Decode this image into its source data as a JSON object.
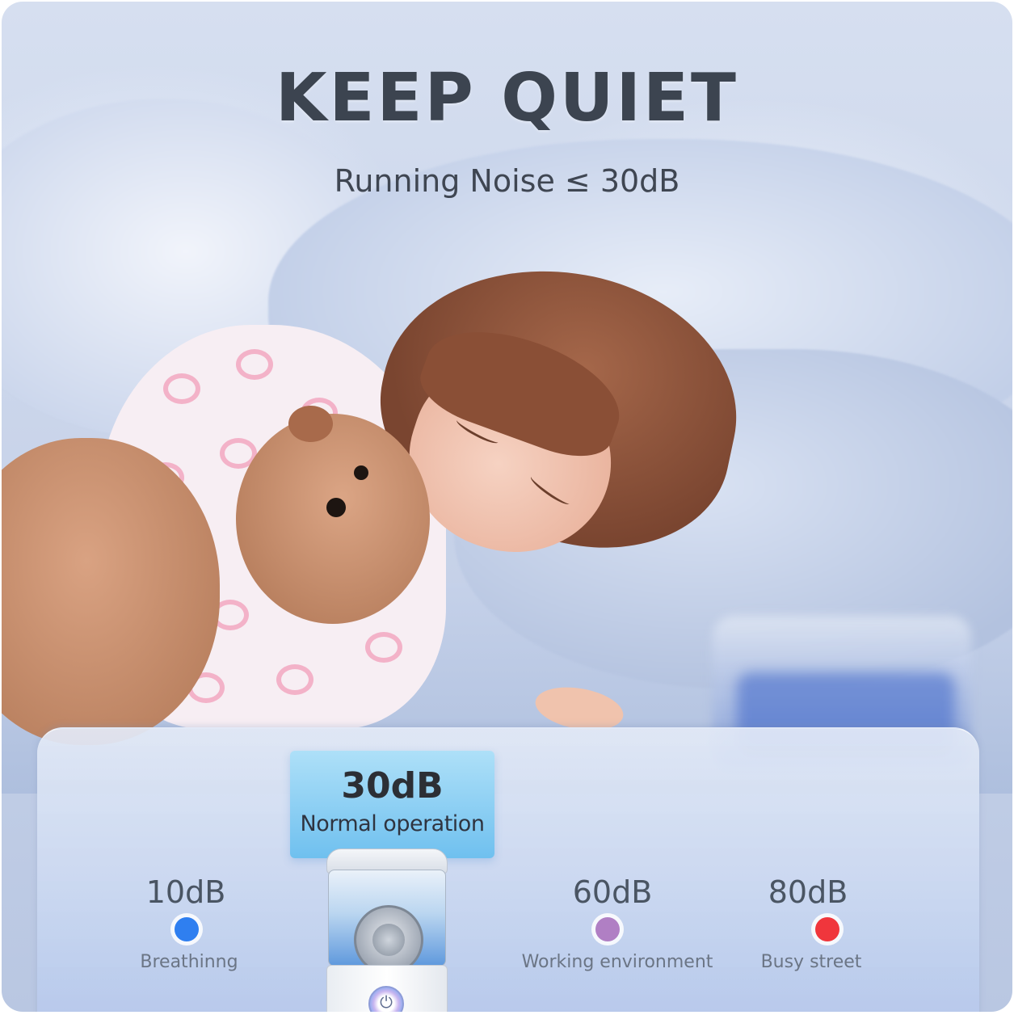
{
  "headline": "KEEP QUIET",
  "subheadline": "Running Noise ≤ 30dB",
  "highlight": {
    "value": "30dB",
    "label": "Normal operation"
  },
  "noise_levels": [
    {
      "value": "10dB",
      "label": "Breathinng",
      "color": "#2f7ff0"
    },
    {
      "value": "60dB",
      "label": "Working environment",
      "color": "#b07fc4"
    },
    {
      "value": "80dB",
      "label": "Busy street",
      "color": "#f0363c"
    }
  ],
  "colors": {
    "scale_start": "#3a86f0",
    "scale_mid": "#9a86d6",
    "scale_end": "#ef3b44",
    "badge_top": "#aee0f8",
    "badge_bottom": "#6fc0ef"
  },
  "icons": {
    "power_button": "power-icon"
  }
}
